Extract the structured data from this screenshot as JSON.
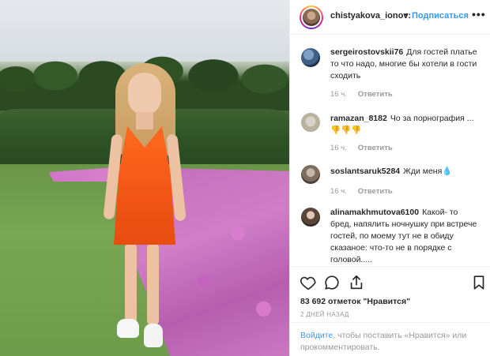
{
  "post": {
    "username": "chistyakova_ionov:",
    "separator": "•",
    "follow_label": "Подписаться",
    "more_label": "•••"
  },
  "comments": [
    {
      "username": "sergeirostovskii76",
      "text": "Для гостей платье то что надо, многие бы хотели в гости сходить",
      "time": "16 ч.",
      "reply_label": "Ответить"
    },
    {
      "username": "ramazan_8182",
      "text": "Чо за порнография ... 👎👎👎",
      "time": "16 ч.",
      "reply_label": "Ответить"
    },
    {
      "username": "soslantsaruk5284",
      "text": "Жди меня💧",
      "time": "16 ч.",
      "reply_label": "Ответить"
    },
    {
      "username": "alinamakhmutova6100",
      "text": "Какой- то бред, напялить ночнушку при встрече гостей, по моему тут не в обиду сказаное: что-то не в порядке с головой.....",
      "time": "",
      "reply_label": ""
    }
  ],
  "actions": {
    "icons": [
      "heart-icon",
      "comment-icon",
      "share-icon",
      "bookmark-icon"
    ],
    "likes_text": "83 692 отметок \"Нравится\"",
    "timestamp": "2 ДНЕЙ НАЗАД"
  },
  "login": {
    "link_text": "Войдите",
    "rest_text": ", чтобы поставить «Нравится» или прокомментировать."
  },
  "colors": {
    "link_blue": "#3897f0",
    "text_dark": "#262626",
    "text_muted": "#999999",
    "divider": "#efefef",
    "dress_orange": "#f25514"
  }
}
